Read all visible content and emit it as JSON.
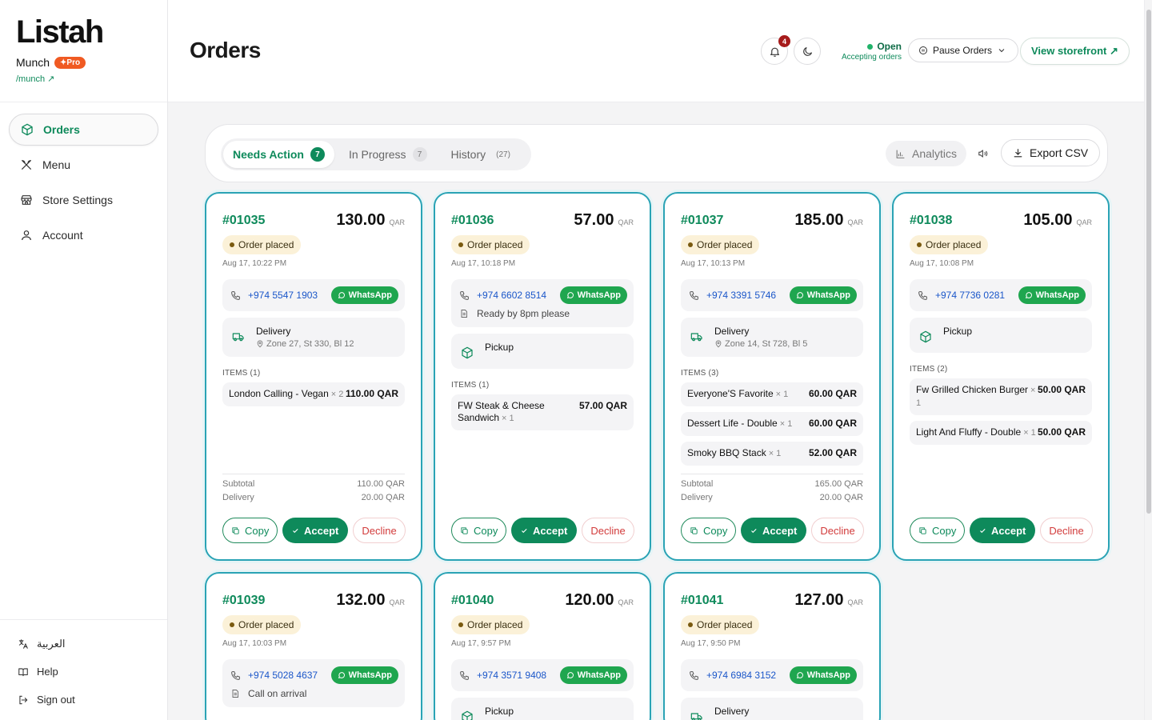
{
  "brand": {
    "logo": "Listah",
    "name": "Munch",
    "badge": "✦Pro",
    "link": "/munch ↗"
  },
  "nav": [
    {
      "label": "Orders",
      "icon": "box-icon"
    },
    {
      "label": "Menu",
      "icon": "utensils-icon"
    },
    {
      "label": "Store Settings",
      "icon": "store-icon"
    },
    {
      "label": "Account",
      "icon": "user-icon"
    }
  ],
  "sidebar_bottom": {
    "language": "العربية",
    "help": "Help",
    "signout": "Sign out"
  },
  "header": {
    "title": "Orders",
    "notif_count": "4",
    "status_label": "Open",
    "status_sub": "Accepting orders",
    "pause_label": "Pause Orders",
    "storefront_label": "View storefront ↗"
  },
  "toolbar": {
    "tabs": [
      {
        "label": "Needs Action",
        "count": "7"
      },
      {
        "label": "In Progress",
        "count": "7"
      },
      {
        "label": "History",
        "count": "(27)"
      }
    ],
    "analytics_label": "Analytics",
    "export_label": "Export CSV"
  },
  "buttons": {
    "copy": "Copy",
    "accept": "Accept",
    "decline": "Decline",
    "whatsapp": "WhatsApp"
  },
  "labels": {
    "subtotal": "Subtotal",
    "delivery": "Delivery",
    "currency": "QAR",
    "status": "Order placed"
  },
  "orders": [
    {
      "id": "#01035",
      "total": "130.00",
      "time": "Aug 17, 10:22 PM",
      "phone": "+974 5547 1903",
      "note": "",
      "type": "Delivery",
      "address": "Zone 27, St 330, Bl 12",
      "items_label": "ITEMS (1)",
      "items": [
        {
          "name": "London Calling - Vegan",
          "qty": "× 2",
          "price": "110.00 QAR"
        }
      ],
      "subtotal": "110.00 QAR",
      "delivery_fee": "20.00 QAR"
    },
    {
      "id": "#01036",
      "total": "57.00",
      "time": "Aug 17, 10:18 PM",
      "phone": "+974 6602 8514",
      "note": "Ready by 8pm please",
      "type": "Pickup",
      "address": "",
      "items_label": "ITEMS (1)",
      "items": [
        {
          "name": "FW Steak & Cheese Sandwich",
          "qty": "× 1",
          "price": "57.00 QAR"
        }
      ],
      "subtotal": "",
      "delivery_fee": ""
    },
    {
      "id": "#01037",
      "total": "185.00",
      "time": "Aug 17, 10:13 PM",
      "phone": "+974 3391 5746",
      "note": "",
      "type": "Delivery",
      "address": "Zone 14, St 728, Bl 5",
      "items_label": "ITEMS (3)",
      "items": [
        {
          "name": "Everyone'S Favorite",
          "qty": "× 1",
          "price": "60.00 QAR"
        },
        {
          "name": "Dessert Life - Double",
          "qty": "× 1",
          "price": "60.00 QAR"
        },
        {
          "name": "Smoky BBQ Stack",
          "qty": "× 1",
          "price": "52.00 QAR"
        }
      ],
      "subtotal": "165.00 QAR",
      "delivery_fee": "20.00 QAR"
    },
    {
      "id": "#01038",
      "total": "105.00",
      "time": "Aug 17, 10:08 PM",
      "phone": "+974 7736 0281",
      "note": "",
      "type": "Pickup",
      "address": "",
      "items_label": "ITEMS (2)",
      "items": [
        {
          "name": "Fw Grilled Chicken Burger",
          "qty": "× 1",
          "price": "50.00 QAR"
        },
        {
          "name": "Light And Fluffy - Double",
          "qty": "× 1",
          "price": "50.00 QAR"
        }
      ],
      "subtotal": "",
      "delivery_fee": ""
    },
    {
      "id": "#01039",
      "total": "132.00",
      "time": "Aug 17, 10:03 PM",
      "phone": "+974 5028 4637",
      "note": "Call on arrival",
      "type": "",
      "address": "",
      "items_label": "",
      "items": [],
      "subtotal": "",
      "delivery_fee": ""
    },
    {
      "id": "#01040",
      "total": "120.00",
      "time": "Aug 17, 9:57 PM",
      "phone": "+974 3571 9408",
      "note": "",
      "type": "Pickup",
      "address": "",
      "items_label": "",
      "items": [],
      "subtotal": "",
      "delivery_fee": ""
    },
    {
      "id": "#01041",
      "total": "127.00",
      "time": "Aug 17, 9:50 PM",
      "phone": "+974 6984 3152",
      "note": "",
      "type": "Delivery",
      "address": "",
      "items_label": "",
      "items": [],
      "subtotal": "",
      "delivery_fee": ""
    }
  ]
}
